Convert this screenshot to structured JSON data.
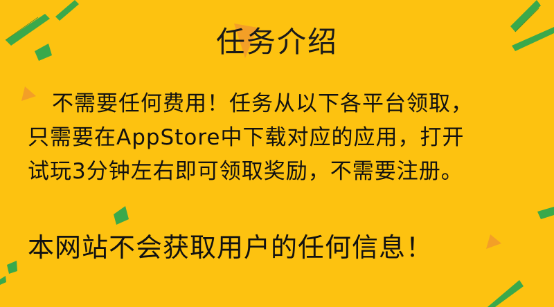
{
  "page": {
    "title": "任务介绍",
    "body_lines": [
      "不需要任何费用！任务从以下各平台领取，",
      "只需要在AppStore中下载对应的应用，打开",
      "试玩3分钟左右即可领取奖励，不需要注册。"
    ],
    "privacy_notice": "本网站不会获取用户的任何信息！"
  },
  "colors": {
    "background": "#FDC210",
    "text": "#111111",
    "accent_green": "#2FA84F",
    "accent_orange": "#F29B2A"
  }
}
